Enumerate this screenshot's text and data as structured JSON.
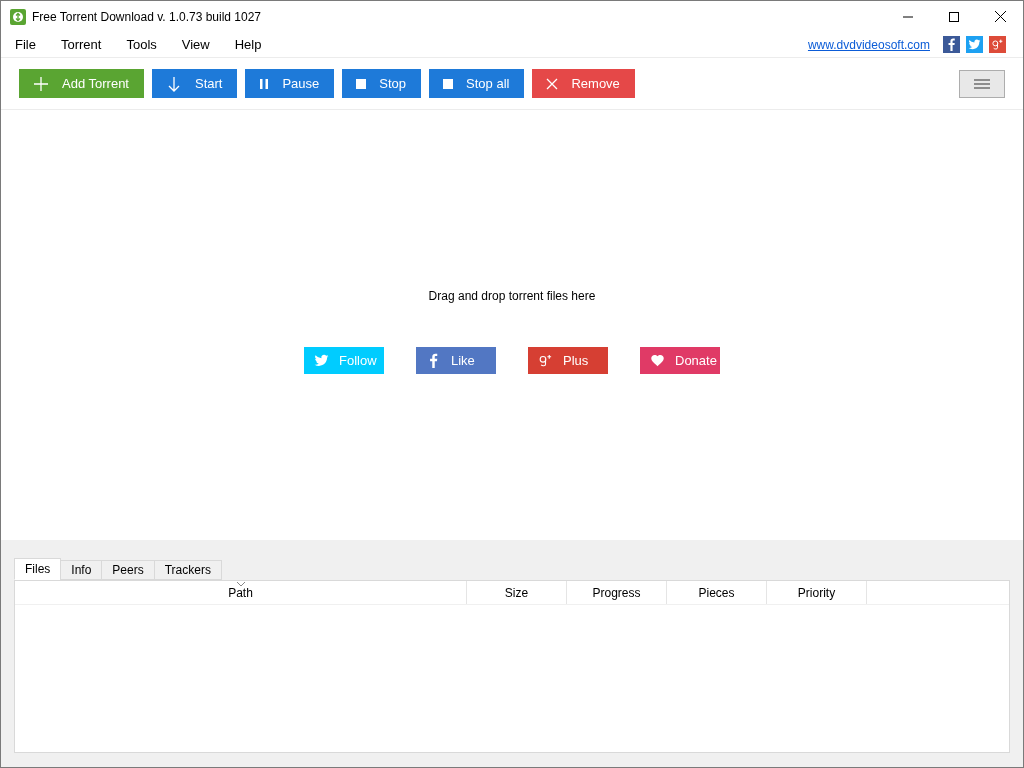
{
  "window": {
    "title": "Free Torrent Download v. 1.0.73 build 1027"
  },
  "menu": [
    "File",
    "Torrent",
    "Tools",
    "View",
    "Help"
  ],
  "website_link": "www.dvdvideosoft.com",
  "social_icons": [
    {
      "kind": "facebook"
    },
    {
      "kind": "twitter"
    },
    {
      "kind": "googleplus"
    }
  ],
  "toolbar": [
    {
      "kind": "add",
      "label": "Add Torrent"
    },
    {
      "kind": "start",
      "label": "Start"
    },
    {
      "kind": "pause",
      "label": "Pause"
    },
    {
      "kind": "stop",
      "label": "Stop"
    },
    {
      "kind": "stopall",
      "label": "Stop all"
    },
    {
      "kind": "remove",
      "label": "Remove"
    }
  ],
  "drop_hint": "Drag and drop torrent files here",
  "social_buttons": [
    {
      "kind": "twitter",
      "label": "Follow"
    },
    {
      "kind": "facebook",
      "label": "Like"
    },
    {
      "kind": "googleplus",
      "label": "Plus"
    },
    {
      "kind": "donate",
      "label": "Donate"
    }
  ],
  "tabs": [
    {
      "label": "Files",
      "selected": true
    },
    {
      "label": "Info",
      "selected": false
    },
    {
      "label": "Peers",
      "selected": false
    },
    {
      "label": "Trackers",
      "selected": false
    }
  ],
  "table": {
    "columns": [
      {
        "label": "Path",
        "sorted": true
      },
      {
        "label": "Size",
        "sorted": false
      },
      {
        "label": "Progress",
        "sorted": false
      },
      {
        "label": "Pieces",
        "sorted": false
      },
      {
        "label": "Priority",
        "sorted": false
      }
    ]
  }
}
